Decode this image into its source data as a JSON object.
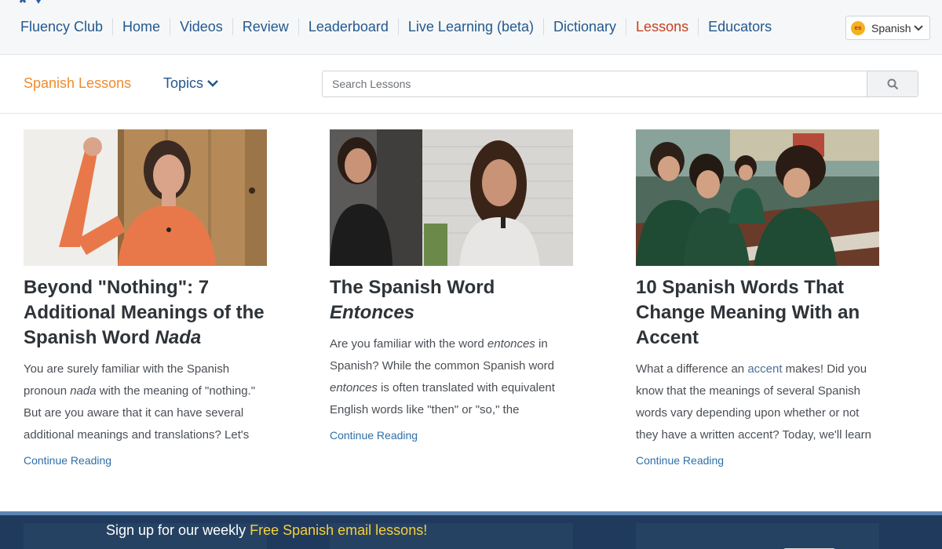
{
  "nav": {
    "items": [
      {
        "label": "Fluency Club",
        "active": false
      },
      {
        "label": "Home",
        "active": false
      },
      {
        "label": "Videos",
        "active": false
      },
      {
        "label": "Review",
        "active": false
      },
      {
        "label": "Leaderboard",
        "active": false
      },
      {
        "label": "Live Learning (beta)",
        "active": false
      },
      {
        "label": "Dictionary",
        "active": false
      },
      {
        "label": "Lessons",
        "active": true
      },
      {
        "label": "Educators",
        "active": false
      }
    ],
    "language": {
      "flag_code": "es",
      "label": "Spanish"
    }
  },
  "subheader": {
    "title": "Spanish Lessons",
    "topics_label": "Topics",
    "search_placeholder": "Search Lessons",
    "search_value": ""
  },
  "cards": [
    {
      "title_plain": "Beyond \"Nothing\": 7 Additional Meanings of the Spanish Word ",
      "title_italic": "Nada",
      "body_1": "You are surely familiar with the Spanish pronoun ",
      "body_italic": "nada",
      "body_2": " with the meaning of \"nothing.\" But are you aware that it can have several additional meanings and translations? Let's",
      "continue_label": "Continue Reading"
    },
    {
      "title_plain": "The Spanish Word ",
      "title_italic": "Entonces",
      "body_1": "Are you familiar with the word ",
      "body_italic": "entonces",
      "body_2": " in Spanish? While the common Spanish word ",
      "body_italic_2": "entonces",
      "body_3": " is often translated with equivalent English words like \"then\" or \"so,\" the",
      "continue_label": "Continue Reading"
    },
    {
      "title_plain": "10 Spanish Words That Change Meaning With an Accent",
      "body_1": "What a difference an ",
      "body_link": "accent",
      "body_2": " makes! Did you know that the meanings of several Spanish words vary depending upon whether or not they have a written accent? Today, we'll learn",
      "continue_label": "Continue Reading"
    }
  ],
  "signup": {
    "text": "Sign up for our weekly ",
    "highlight": "Free Spanish email lessons!"
  },
  "colors": {
    "nav_link": "#23598f",
    "nav_active": "#c7401e",
    "accent_orange": "#f18a2c",
    "signup_bg": "#1f3a5c",
    "signup_highlight": "#f7cf3c"
  }
}
